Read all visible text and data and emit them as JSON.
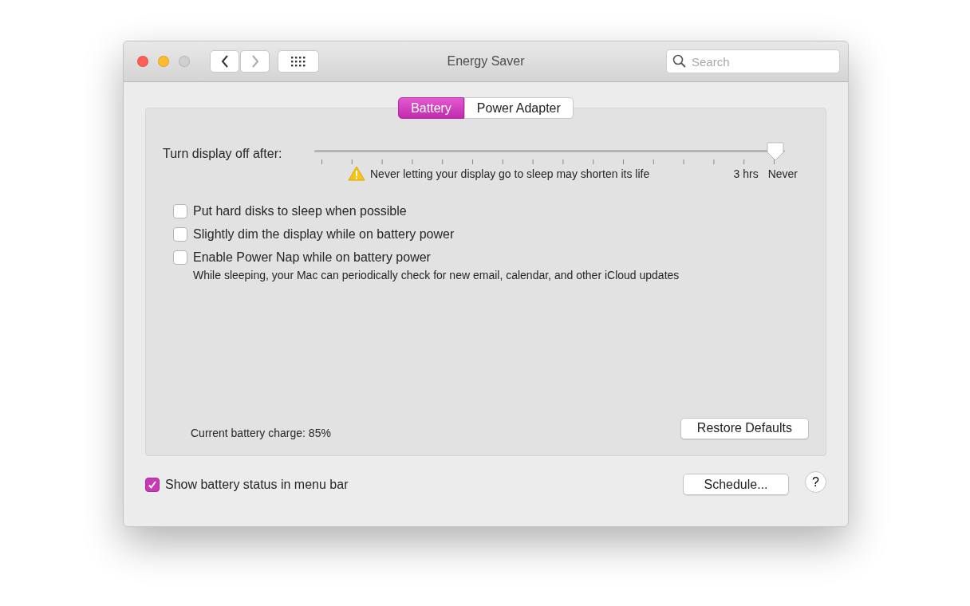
{
  "window": {
    "title": "Energy Saver"
  },
  "search": {
    "placeholder": "Search"
  },
  "tabs": [
    {
      "label": "Battery",
      "selected": true
    },
    {
      "label": "Power Adapter",
      "selected": false
    }
  ],
  "slider": {
    "label": "Turn display off after:",
    "level": 1,
    "warning": "Never letting your display go to sleep may shorten its life",
    "tick_labels": [
      "3 hrs",
      "Never"
    ]
  },
  "options": [
    {
      "label": "Put hard disks to sleep when possible",
      "checked": false
    },
    {
      "label": "Slightly dim the display while on battery power",
      "checked": false
    },
    {
      "label": "Enable Power Nap while on battery power",
      "checked": false,
      "note": "While sleeping, your Mac can periodically check for new email, calendar, and other iCloud updates"
    }
  ],
  "charge": "Current battery charge: 85%",
  "restore_button": "Restore Defaults",
  "menu_bar_option": {
    "label": "Show battery status in menu bar",
    "checked": true
  },
  "schedule_button": "Schedule...",
  "help_button": "?"
}
